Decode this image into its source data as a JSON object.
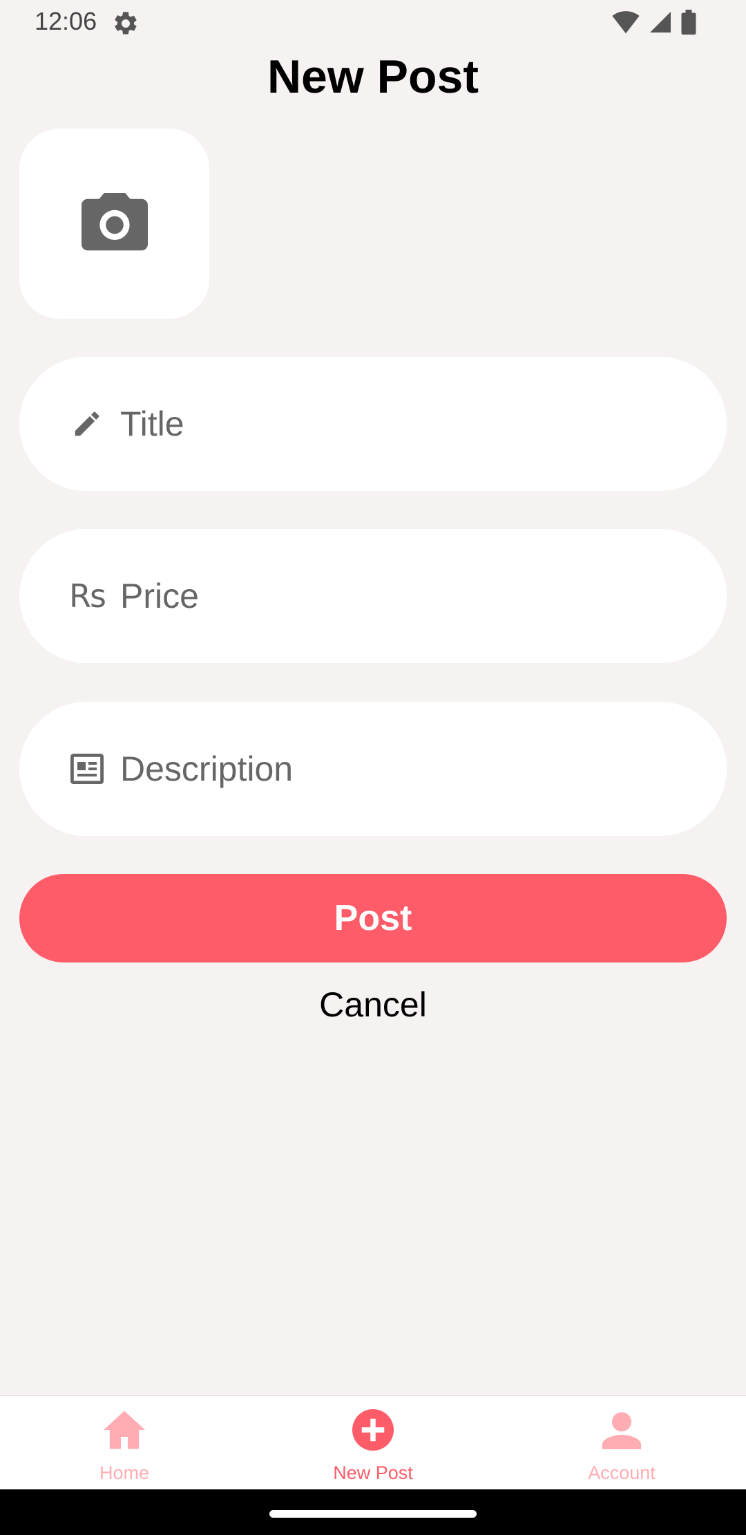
{
  "status_bar": {
    "time": "12:06",
    "icons": [
      "gear-icon",
      "wifi-icon",
      "signal-icon",
      "battery-icon"
    ]
  },
  "page": {
    "title": "New Post"
  },
  "photo_picker": {
    "icon": "camera-icon"
  },
  "form": {
    "title": {
      "placeholder": "Title",
      "value": "",
      "icon": "pencil-icon"
    },
    "price": {
      "placeholder": "Price",
      "value": "",
      "icon": "rupee-icon",
      "icon_glyph": "Rs"
    },
    "description": {
      "placeholder": "Description",
      "value": "",
      "icon": "article-icon"
    }
  },
  "actions": {
    "post_label": "Post",
    "cancel_label": "Cancel"
  },
  "bottom_nav": {
    "items": [
      {
        "label": "Home",
        "icon": "home-icon",
        "active": false
      },
      {
        "label": "New Post",
        "icon": "add-circle-icon",
        "active": true
      },
      {
        "label": "Account",
        "icon": "person-icon",
        "active": false
      }
    ]
  },
  "colors": {
    "background": "#f6f2f2",
    "accent": "#fe5c68",
    "accent_light": "#ffadb3",
    "field_bg": "#ffffff",
    "icon_gray": "#666666"
  }
}
